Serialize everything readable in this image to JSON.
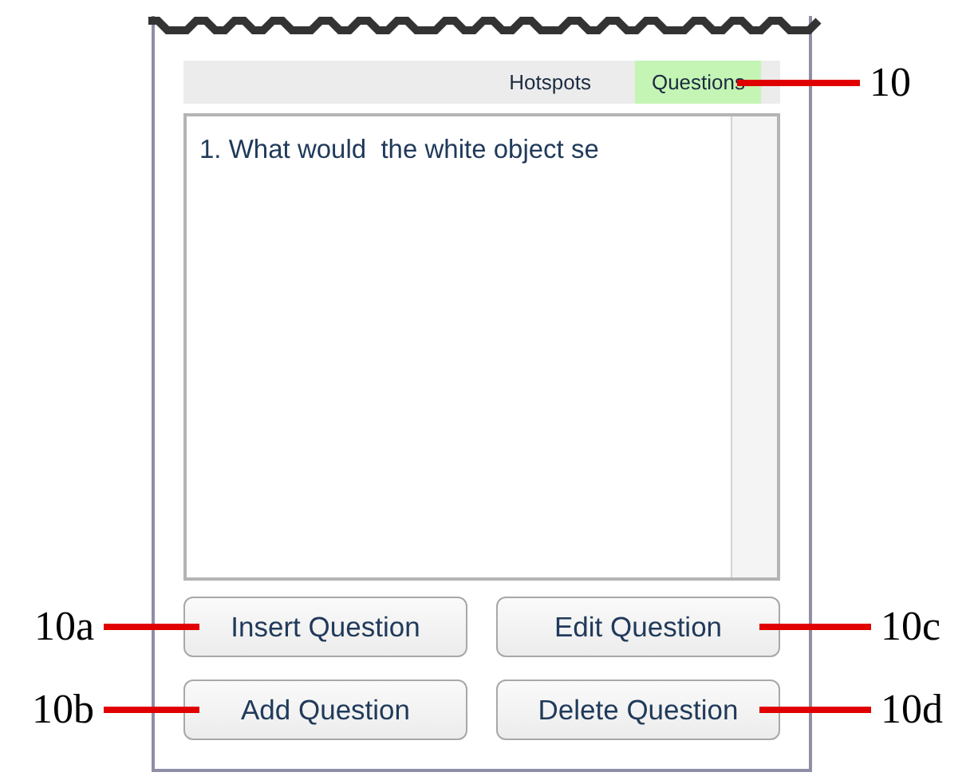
{
  "tabs": [
    {
      "label": "Hotspots",
      "selected": false
    },
    {
      "label": "Questions",
      "selected": true,
      "callout": "10"
    }
  ],
  "questions": [
    {
      "text": "1. What would  the white object se"
    }
  ],
  "buttons": [
    {
      "label": "Insert Question",
      "callout": "10a"
    },
    {
      "label": "Edit Question",
      "callout": "10c"
    },
    {
      "label": "Add Question",
      "callout": "10b"
    },
    {
      "label": "Delete Question",
      "callout": "10d"
    }
  ]
}
